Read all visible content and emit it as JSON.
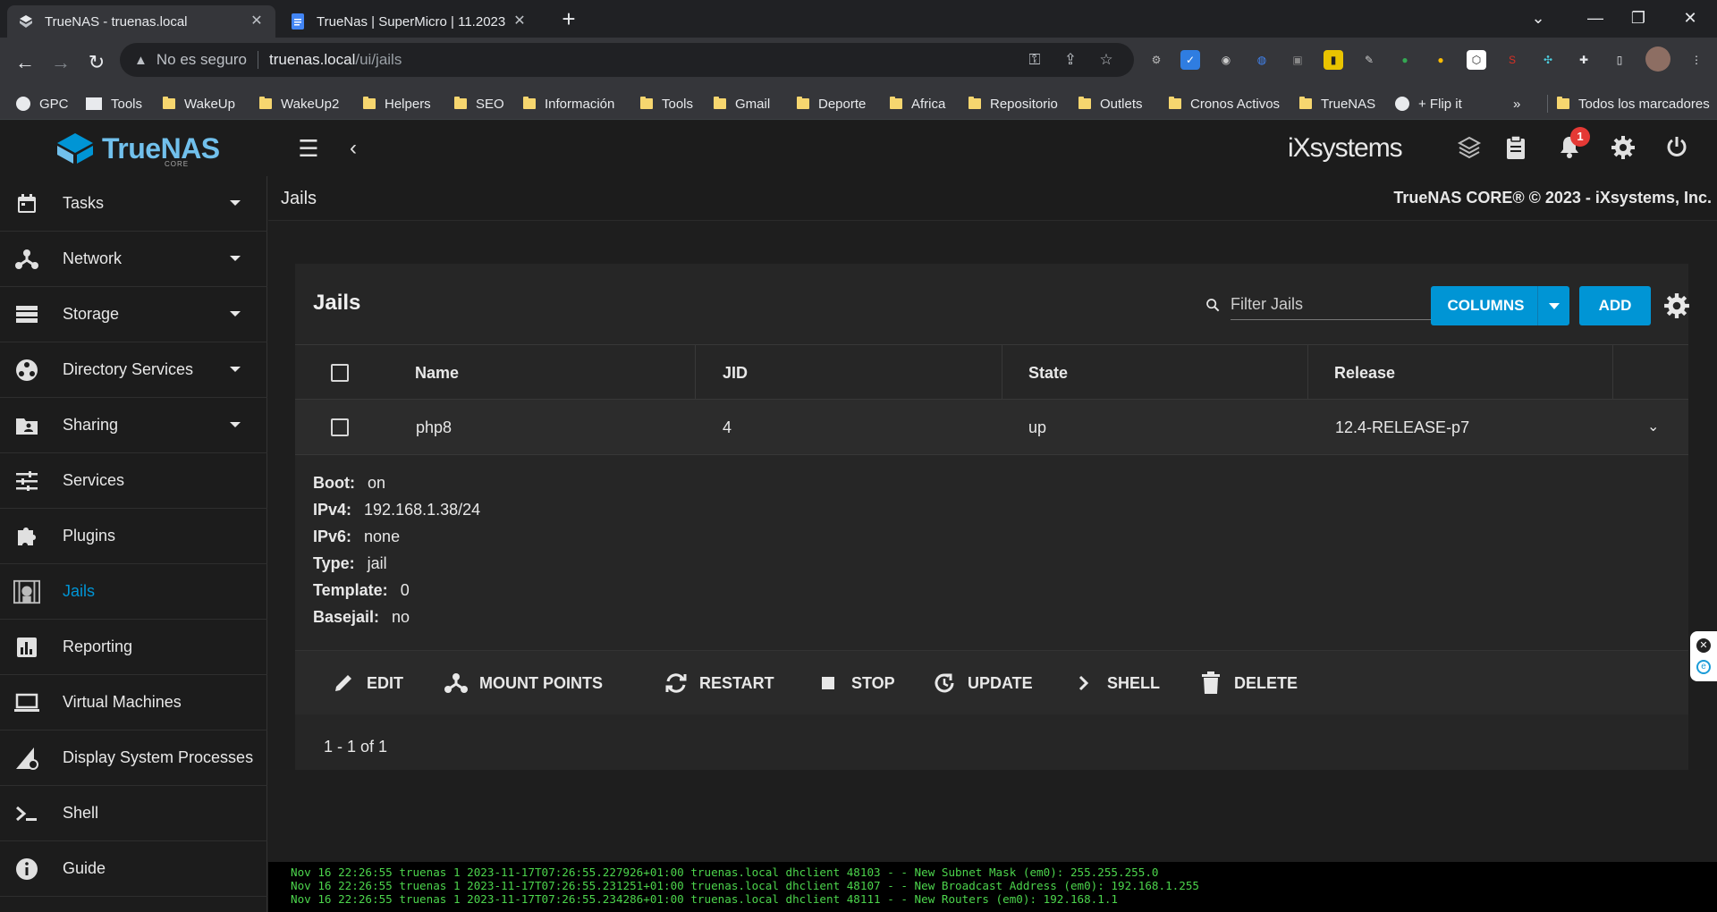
{
  "browser": {
    "tabs": [
      {
        "title": "TrueNAS - truenas.local"
      },
      {
        "title": "TrueNas | SuperMicro | 11.2023"
      }
    ],
    "url": {
      "security": "No es seguro",
      "host": "truenas.local",
      "path": "/ui/jails"
    },
    "bookmarks": [
      "GPC",
      "Tools",
      "WakeUp",
      "WakeUp2",
      "Helpers",
      "SEO",
      "Información",
      "Tools",
      "Gmail",
      "Deporte",
      "Africa",
      "Repositorio",
      "Outlets",
      "Cronos Activos",
      "TrueNAS",
      "+ Flip it"
    ],
    "bookmarks_more": "»",
    "all_bookmarks": "Todos los marcadores"
  },
  "app": {
    "logo_text": "TrueNAS",
    "logo_sub": "CORE",
    "vendor_logo": "iXsystems",
    "notification_count": "1",
    "sidebar": [
      {
        "label": "Tasks",
        "icon": "calendar-icon",
        "expandable": true
      },
      {
        "label": "Network",
        "icon": "network-icon",
        "expandable": true
      },
      {
        "label": "Storage",
        "icon": "storage-icon",
        "expandable": true
      },
      {
        "label": "Directory Services",
        "icon": "directory-icon",
        "expandable": true
      },
      {
        "label": "Sharing",
        "icon": "folder-share-icon",
        "expandable": true
      },
      {
        "label": "Services",
        "icon": "tune-icon",
        "expandable": false
      },
      {
        "label": "Plugins",
        "icon": "puzzle-icon",
        "expandable": false
      },
      {
        "label": "Jails",
        "icon": "jail-icon",
        "expandable": false,
        "active": true
      },
      {
        "label": "Reporting",
        "icon": "chart-icon",
        "expandable": false
      },
      {
        "label": "Virtual Machines",
        "icon": "laptop-icon",
        "expandable": false
      },
      {
        "label": "Display System Processes",
        "icon": "processes-icon",
        "expandable": false
      },
      {
        "label": "Shell",
        "icon": "terminal-icon",
        "expandable": false
      },
      {
        "label": "Guide",
        "icon": "info-icon",
        "expandable": false
      }
    ],
    "page_title": "Jails",
    "copyright": "TrueNAS CORE® © 2023 - iXsystems, Inc.",
    "card": {
      "title": "Jails",
      "filter_placeholder": "Filter Jails",
      "columns_button": "COLUMNS",
      "add_button": "ADD",
      "headers": [
        "Name",
        "JID",
        "State",
        "Release"
      ],
      "rows": [
        {
          "name": "php8",
          "jid": "4",
          "state": "up",
          "release": "12.4-RELEASE-p7"
        }
      ],
      "details": [
        {
          "label": "Boot:",
          "value": "on"
        },
        {
          "label": "IPv4:",
          "value": "192.168.1.38/24"
        },
        {
          "label": "IPv6:",
          "value": "none"
        },
        {
          "label": "Type:",
          "value": "jail"
        },
        {
          "label": "Template:",
          "value": "0"
        },
        {
          "label": "Basejail:",
          "value": "no"
        }
      ],
      "actions": [
        {
          "label": "EDIT",
          "icon": "pencil-icon"
        },
        {
          "label": "MOUNT POINTS",
          "icon": "mount-icon"
        },
        {
          "label": "RESTART",
          "icon": "restart-icon"
        },
        {
          "label": "STOP",
          "icon": "stop-icon"
        },
        {
          "label": "UPDATE",
          "icon": "update-icon"
        },
        {
          "label": "SHELL",
          "icon": "chevron-right-icon"
        },
        {
          "label": "DELETE",
          "icon": "trash-icon"
        }
      ],
      "pager": "1 - 1 of 1"
    },
    "console_lines": [
      "Nov 16 22:26:55 truenas 1 2023-11-17T07:26:55.227926+01:00 truenas.local dhclient 48103 - - New Subnet Mask (em0): 255.255.255.0",
      "Nov 16 22:26:55 truenas 1 2023-11-17T07:26:55.231251+01:00 truenas.local dhclient 48107 - - New Broadcast Address (em0): 192.168.1.255",
      "Nov 16 22:26:55 truenas 1 2023-11-17T07:26:55.234286+01:00 truenas.local dhclient 48111 - - New Routers (em0): 192.168.1.1"
    ],
    "colors": {
      "accent": "#0095d5",
      "console_text": "#4cd44c"
    }
  }
}
